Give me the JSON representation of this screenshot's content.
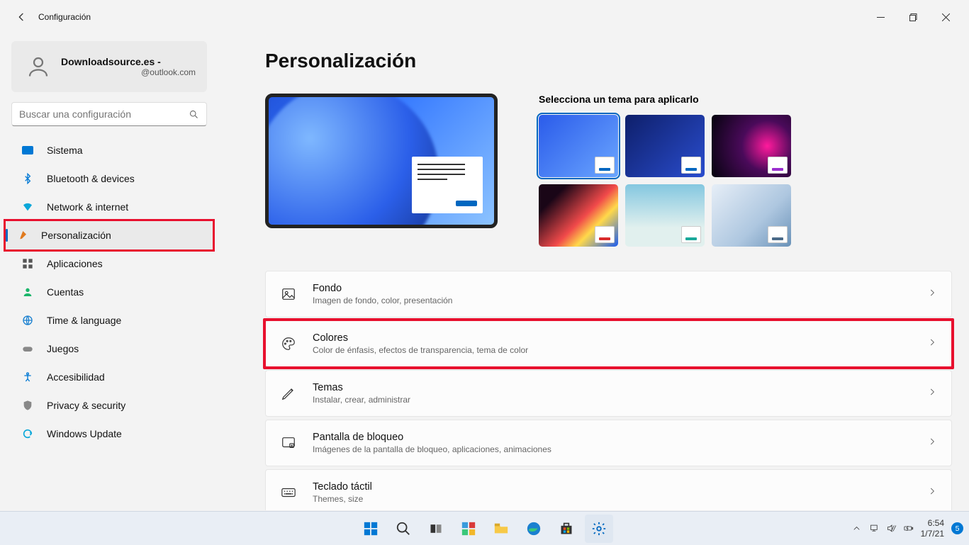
{
  "window": {
    "title": "Configuración"
  },
  "user": {
    "name": "Downloadsource.es -",
    "email": "@outlook.com"
  },
  "search": {
    "placeholder": "Buscar una configuración"
  },
  "nav": [
    {
      "label": "Sistema"
    },
    {
      "label": "Bluetooth & devices"
    },
    {
      "label": "Network & internet"
    },
    {
      "label": "Personalización"
    },
    {
      "label": "Aplicaciones"
    },
    {
      "label": "Cuentas"
    },
    {
      "label": "Time & language"
    },
    {
      "label": "Juegos"
    },
    {
      "label": "Accesibilidad"
    },
    {
      "label": "Privacy & security"
    },
    {
      "label": "Windows Update"
    }
  ],
  "page": {
    "title": "Personalización",
    "themes_heading": "Selecciona un tema para aplicarlo"
  },
  "rows": [
    {
      "title": "Fondo",
      "desc": "Imagen de fondo, color, presentación"
    },
    {
      "title": "Colores",
      "desc": "Color de énfasis, efectos de transparencia, tema de color"
    },
    {
      "title": "Temas",
      "desc": "Instalar, crear, administrar"
    },
    {
      "title": "Pantalla de bloqueo",
      "desc": "Imágenes de la pantalla de bloqueo, aplicaciones, animaciones"
    },
    {
      "title": "Teclado táctil",
      "desc": "Themes, size"
    }
  ],
  "theme_accents": [
    "#0067c0",
    "#0067c0",
    "#9b2fcf",
    "#d92b2b",
    "#1aa89a",
    "#4a6a88"
  ],
  "taskbar": {
    "time": "6:54",
    "date": "1/7/21",
    "badge": "5"
  }
}
